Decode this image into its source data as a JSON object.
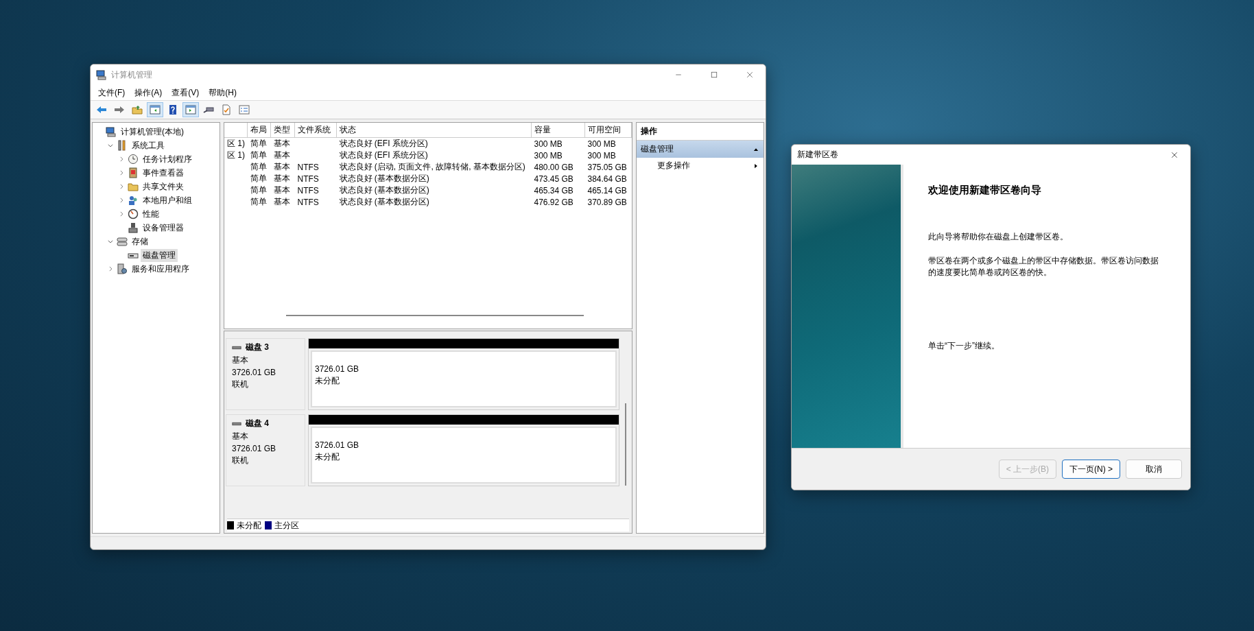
{
  "main_window": {
    "title": "计算机管理",
    "menu": [
      "文件(F)",
      "操作(A)",
      "查看(V)",
      "帮助(H)"
    ],
    "toolbar": [
      {
        "kind": "back",
        "pressed": false
      },
      {
        "kind": "forward",
        "pressed": false
      },
      {
        "kind": "up",
        "pressed": false
      },
      {
        "kind": "tree-pane",
        "pressed": true
      },
      {
        "kind": "help",
        "pressed": false
      },
      {
        "kind": "action-pane",
        "pressed": true
      },
      {
        "kind": "connect",
        "pressed": false
      },
      {
        "kind": "properties",
        "pressed": false
      },
      {
        "kind": "list",
        "pressed": false
      }
    ],
    "tree": [
      {
        "label": "计算机管理(本地)",
        "kind": "computer",
        "selected": false,
        "children": [
          {
            "label": "系统工具",
            "kind": "tools",
            "expanded": true,
            "selected": false,
            "children": [
              {
                "label": "任务计划程序",
                "kind": "clock",
                "expanded": false,
                "selected": false
              },
              {
                "label": "事件查看器",
                "kind": "log",
                "expanded": false,
                "selected": false
              },
              {
                "label": "共享文件夹",
                "kind": "folder",
                "expanded": false,
                "selected": false
              },
              {
                "label": "本地用户和组",
                "kind": "users",
                "expanded": false,
                "selected": false
              },
              {
                "label": "性能",
                "kind": "gauge",
                "expanded": false,
                "selected": false
              },
              {
                "label": "设备管理器",
                "kind": "device",
                "selected": false
              }
            ]
          },
          {
            "label": "存储",
            "kind": "storage",
            "expanded": true,
            "selected": false,
            "children": [
              {
                "label": "磁盘管理",
                "kind": "disk",
                "selected": true
              }
            ]
          },
          {
            "label": "服务和应用程序",
            "kind": "services",
            "expanded": false,
            "selected": false
          }
        ]
      }
    ],
    "table": {
      "columns": [
        null,
        "布局",
        "类型",
        "文件系统",
        "状态",
        "容量",
        "可用空间"
      ],
      "rows": [
        [
          "区 1)",
          "简单",
          "基本",
          null,
          "状态良好 (EFI 系统分区)",
          "300 MB",
          "300 MB"
        ],
        [
          "区 1)",
          "简单",
          "基本",
          null,
          "状态良好 (EFI 系统分区)",
          "300 MB",
          "300 MB"
        ],
        [
          null,
          "简单",
          "基本",
          "NTFS",
          "状态良好 (启动, 页面文件, 故障转储, 基本数据分区)",
          "480.00 GB",
          "375.05 GB"
        ],
        [
          null,
          "简单",
          "基本",
          "NTFS",
          "状态良好 (基本数据分区)",
          "473.45 GB",
          "384.64 GB"
        ],
        [
          null,
          "简单",
          "基本",
          "NTFS",
          "状态良好 (基本数据分区)",
          "465.34 GB",
          "465.14 GB"
        ],
        [
          null,
          "简单",
          "基本",
          "NTFS",
          "状态良好 (基本数据分区)",
          "476.92 GB",
          "370.89 GB"
        ]
      ]
    },
    "disks": [
      {
        "name": "磁盘 3",
        "type": "基本",
        "size": "3726.01 GB",
        "status": "联机",
        "partitions": [
          {
            "size": "3726.01 GB",
            "label": "未分配",
            "color": "#000000"
          }
        ]
      },
      {
        "name": "磁盘 4",
        "type": "基本",
        "size": "3726.01 GB",
        "status": "联机",
        "partitions": [
          {
            "size": "3726.01 GB",
            "label": "未分配",
            "color": "#000000"
          }
        ]
      }
    ],
    "legend": [
      {
        "label": "未分配",
        "color": "#000000"
      },
      {
        "label": "主分区",
        "color": "#000080"
      }
    ],
    "actions": {
      "title": "操作",
      "sections": [
        {
          "label": "磁盘管理",
          "expanded": true,
          "items": [
            {
              "label": "更多操作"
            }
          ]
        }
      ]
    }
  },
  "dialog": {
    "title": "新建带区卷",
    "heading": "欢迎使用新建带区卷向导",
    "paragraphs": [
      "此向导将帮助你在磁盘上创建带区卷。",
      "带区卷在两个或多个磁盘上的带区中存储数据。带区卷访问数据的速度要比简单卷或跨区卷的快。",
      "单击“下一步”继续。"
    ],
    "buttons": [
      {
        "label": "< 上一步(B)",
        "disabled": true,
        "default": false
      },
      {
        "label": "下一页(N) >",
        "disabled": false,
        "default": true
      },
      {
        "label": "取消",
        "disabled": false,
        "default": false
      }
    ]
  }
}
